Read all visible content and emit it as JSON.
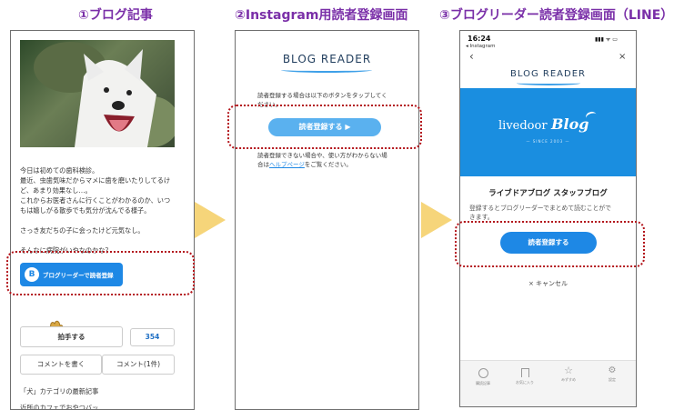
{
  "steps": {
    "step1": "①ブログ記事",
    "step2": "②Instagram用読者登録画面",
    "step3": "③ブログリーダー読者登録画面（LINE）"
  },
  "panel1": {
    "article_lines": [
      "今日は初めての歯科検診。",
      "最近、虫歯気味だからマメに歯を磨いたりしてるけ",
      "ど、あまり効果なし…。",
      "これからお医者さんに行くことがわかるのか、いつ",
      "もは嬉しがる散歩でも気分が沈んでる様子。",
      "",
      "さっき友だちの子に会ったけど元気なし。",
      "",
      "そんなに病院がいやなのかな？"
    ],
    "reader_button_label": "ブログリーダーで読者登録",
    "reader_button_icon_letter": "B",
    "clap_label": "拍手する",
    "clap_count": "354",
    "comment_write_label": "コメントを書く",
    "comment_count_label": "コメント(1件)",
    "category_heading": "「犬」カテゴリの最新記事",
    "recent_article_cut": "近所のカフェでおやつバッ... "
  },
  "panel2": {
    "logo": "BLOG READER",
    "intro_line1": "読者登録する場合は以下のボタンをタップしてく",
    "intro_line2": "ださい。",
    "register_label": "読者登録する ▶",
    "help_line1": "読者登録できない場合や、使い方がわからない場",
    "help_prefix": "合は",
    "help_link": "ヘルプページ",
    "help_suffix": "をご覧ください。"
  },
  "panel3": {
    "status_time": "16:24",
    "status_back": "◂ Instagram",
    "status_icons": "▮▮▮ ᯤ ▭",
    "back_glyph": "‹",
    "close_glyph": "×",
    "logo": "BLOG READER",
    "banner_livedoor": "livedoor",
    "banner_blog": "Blog",
    "banner_sub": "— SINCE 2003 —",
    "blog_name": "ライブドアブログ スタッフブログ",
    "desc_line1": "登録するとブログリーダーでまとめて読むことがで",
    "desc_line2": "きます。",
    "register_label": "読者登録する",
    "cancel_label": "× キャンセル",
    "tabs": [
      "購読記事",
      "お気に入り",
      "みずすめ",
      "設定"
    ]
  },
  "colors": {
    "title_purple": "#7a2fa8",
    "arrow_yellow": "#f6d57a",
    "highlight_red": "#b3141b",
    "button_blue": "#1e88e5",
    "light_blue": "#5ab1ef",
    "banner_blue": "#1a8ee0"
  }
}
